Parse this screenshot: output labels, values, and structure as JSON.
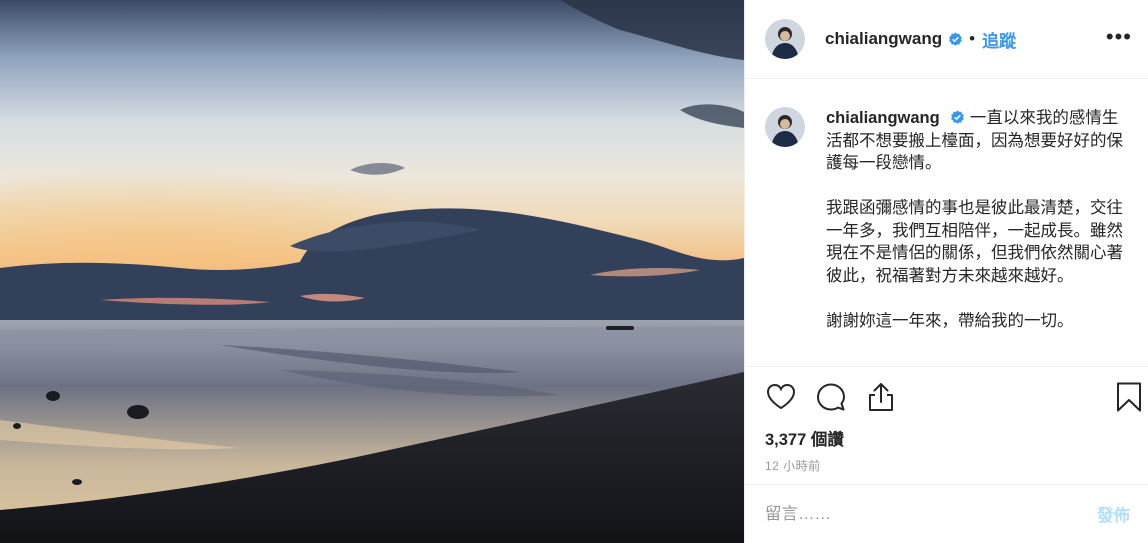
{
  "post": {
    "photo_icon": "sunset-seascape-photo",
    "header": {
      "username": "chialiangwang",
      "verified_icon": "verified-badge-icon",
      "separator": "•",
      "follow_label": "追蹤",
      "more_label": "•••"
    },
    "caption": {
      "username": "chialiangwang",
      "paragraphs": [
        "一直以來我的感情生活都不想要搬上檯面，因為想要好好的保護每一段戀情。",
        "我跟函彌感情的事也是彼此最清楚，交往一年多，我們互相陪伴，一起成長。雖然現在不是情侶的關係，但我們依然關心著彼此，祝福著對方未來越來越好。",
        "謝謝妳這一年來，帶給我的一切。"
      ]
    },
    "actions": {
      "like_icon": "heart-icon",
      "comment_icon": "comment-bubble-icon",
      "share_icon": "share-icon",
      "save_icon": "bookmark-icon",
      "views": "3,377 個讚",
      "time": "12 小時前"
    },
    "comment": {
      "placeholder": "留言……",
      "post_label": "發佈"
    },
    "colors": {
      "link_blue": "#3897f0",
      "post_disabled": "#b2dffc",
      "verified_blue": "#3897f0"
    }
  }
}
